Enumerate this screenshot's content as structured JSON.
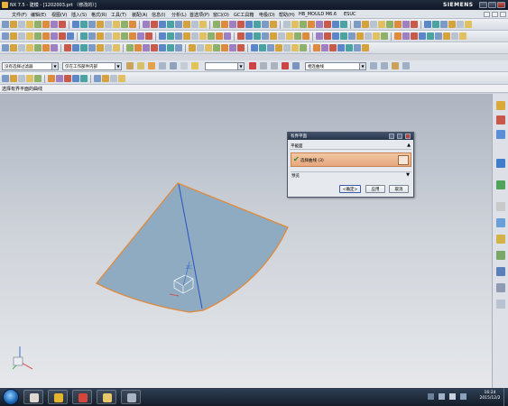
{
  "window": {
    "title": "NX 7.5 - 建模 - [1202003.prt （修改的）]",
    "brand": "SIEMENS"
  },
  "menu": {
    "items": [
      "文件(F)",
      "编辑(E)",
      "视图(V)",
      "插入(S)",
      "格式(R)",
      "工具(T)",
      "装配(A)",
      "信息(I)",
      "分析(L)",
      "首选项(P)",
      "窗口(O)",
      "GC工具箱",
      "电极(D)",
      "帮助(H)",
      "HB_MOULD M6.6",
      "ESUC"
    ]
  },
  "filterbar": {
    "selection_filter": "没有选择过滤器",
    "scope": "仅在工作部件内部",
    "curve_rule": "相连曲线"
  },
  "cue_line": "选择有界平面的曲线",
  "dialog": {
    "title": "有界平面",
    "section": "平截面",
    "select_curve": "选择曲线 (3)",
    "preview": "预览",
    "ok": "<确定>",
    "apply": "应用",
    "cancel": "取消"
  },
  "viewport": {
    "sketch_label": "ZC"
  },
  "taskbar": {
    "time": "16:24",
    "date": "2015/12/2"
  },
  "colors": {
    "surface_fill": "#8fabc1",
    "surface_edge": "#e08a3c",
    "axis_line": "#2a52c4",
    "title_bar": "#0f1726",
    "dialog_selection": "#e6a77d"
  }
}
